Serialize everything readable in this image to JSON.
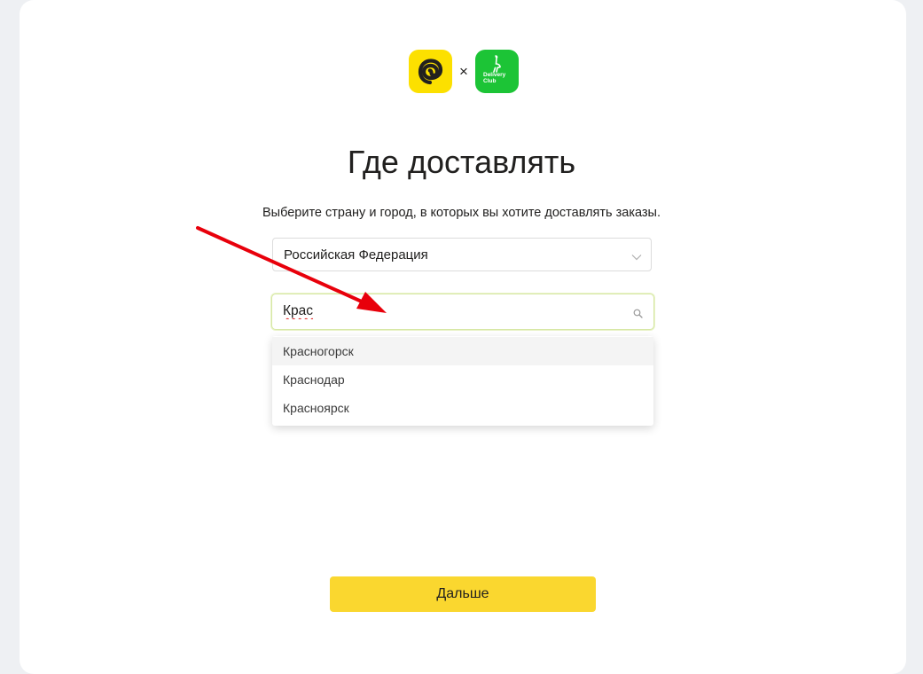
{
  "header": {
    "logo_separator": "×",
    "partner_logo_text_line1": "Delivery",
    "partner_logo_text_line2": "Club"
  },
  "main": {
    "title": "Где доставлять",
    "subtitle": "Выберите страну и город, в которых вы хотите доставлять заказы.",
    "country_select": {
      "value": "Российская Федерация"
    },
    "city_input": {
      "value": "Крас"
    },
    "suggestions": [
      {
        "label": "Красногорск"
      },
      {
        "label": "Краснодар"
      },
      {
        "label": "Красноярск"
      }
    ],
    "next_button_label": "Дальше"
  },
  "colors": {
    "accent_yellow": "#fad72f",
    "logo_yellow": "#fce000",
    "logo_green": "#1cc436",
    "annotation_arrow": "#e8000b"
  },
  "icons": {
    "country_select": "chevron-down-icon",
    "city_input": "search-icon",
    "logo_left": "spiral-logo-icon",
    "logo_right": "ostrich-logo-icon"
  }
}
